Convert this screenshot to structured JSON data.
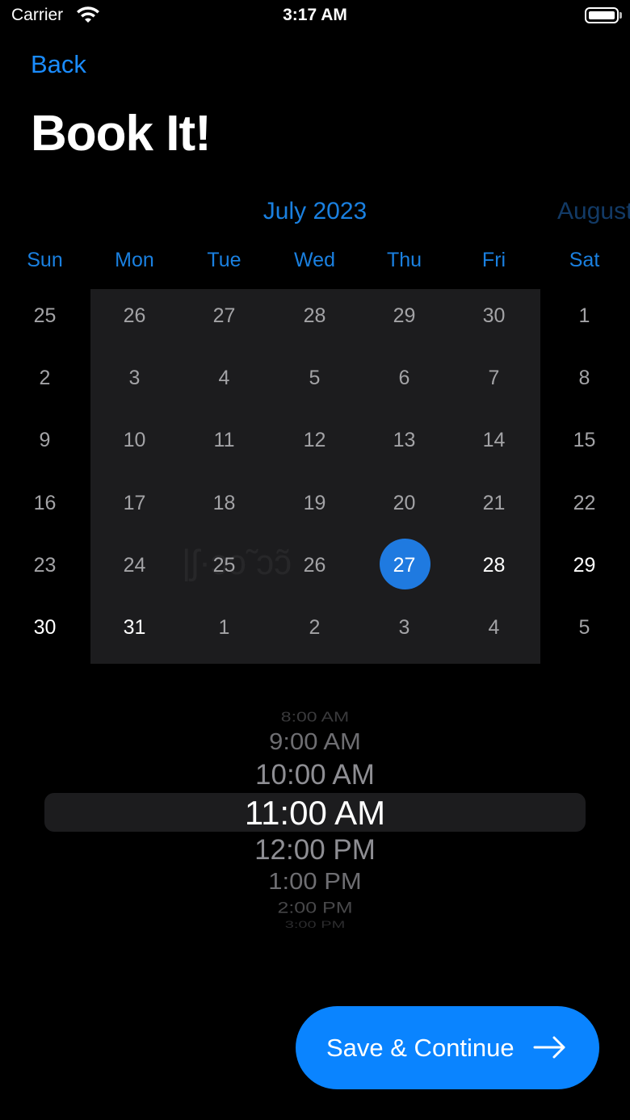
{
  "status_bar": {
    "carrier": "Carrier",
    "time": "3:17 AM"
  },
  "nav": {
    "back_label": "Back"
  },
  "page": {
    "title": "Book It!"
  },
  "calendar": {
    "month_label": "July 2023",
    "next_month_label": "August",
    "weekdays": [
      "Sun",
      "Mon",
      "Tue",
      "Wed",
      "Thu",
      "Fri",
      "Sat"
    ],
    "weeks": [
      [
        "25",
        "26",
        "27",
        "28",
        "29",
        "30",
        "1"
      ],
      [
        "2",
        "3",
        "4",
        "5",
        "6",
        "7",
        "8"
      ],
      [
        "9",
        "10",
        "11",
        "12",
        "13",
        "14",
        "15"
      ],
      [
        "16",
        "17",
        "18",
        "19",
        "20",
        "21",
        "22"
      ],
      [
        "23",
        "24",
        "25",
        "26",
        "27",
        "28",
        "29"
      ],
      [
        "30",
        "31",
        "1",
        "2",
        "3",
        "4",
        "5"
      ]
    ],
    "selected_date": "27",
    "accent_color": "#1a80e0"
  },
  "time_picker": {
    "options": [
      "8:00 AM",
      "9:00 AM",
      "10:00 AM",
      "11:00 AM",
      "12:00 PM",
      "1:00 PM",
      "2:00 PM",
      "3:00 PM"
    ],
    "selected": "11:00 AM"
  },
  "cta": {
    "label": "Save & Continue",
    "color": "#0a84ff",
    "icon": "arrow-right-icon"
  }
}
